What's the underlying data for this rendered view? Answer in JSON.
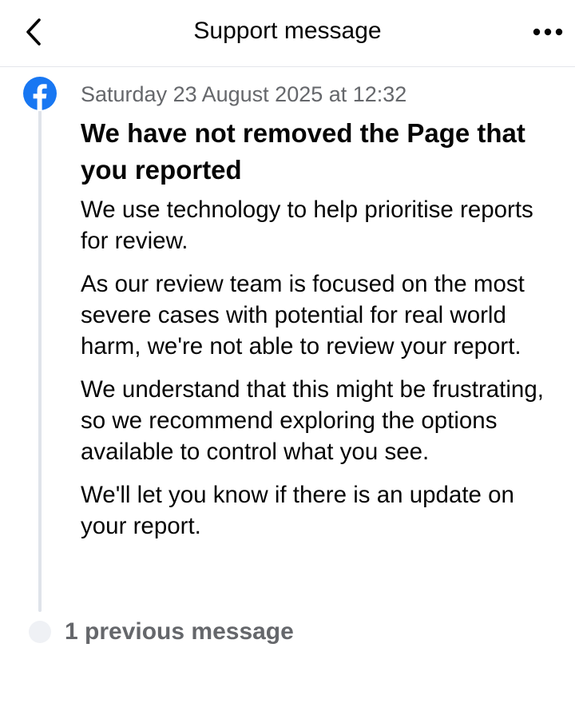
{
  "header": {
    "title": "Support message",
    "back_icon": "chevron-left-icon",
    "more_icon": "more-horizontal-icon"
  },
  "message": {
    "sender_icon": "facebook-logo-icon",
    "timestamp": "Saturday 23 August 2025 at 12:32",
    "headline": "We have not removed the Page that you reported",
    "paragraphs": [
      "We use technology to help prioritise reports for review.",
      "As our review team is focused on the most severe cases with potential for real world harm, we're not able to review your report.",
      "We understand that this might be frustrating, so we recommend exploring the options available to control what you see.",
      "We'll let you know if there is an update on your report."
    ]
  },
  "previous": {
    "label": "1 previous message"
  },
  "colors": {
    "brand": "#1877f2",
    "secondary_text": "#65676b",
    "primary_text": "#050505",
    "timeline": "#dfe3ea"
  }
}
